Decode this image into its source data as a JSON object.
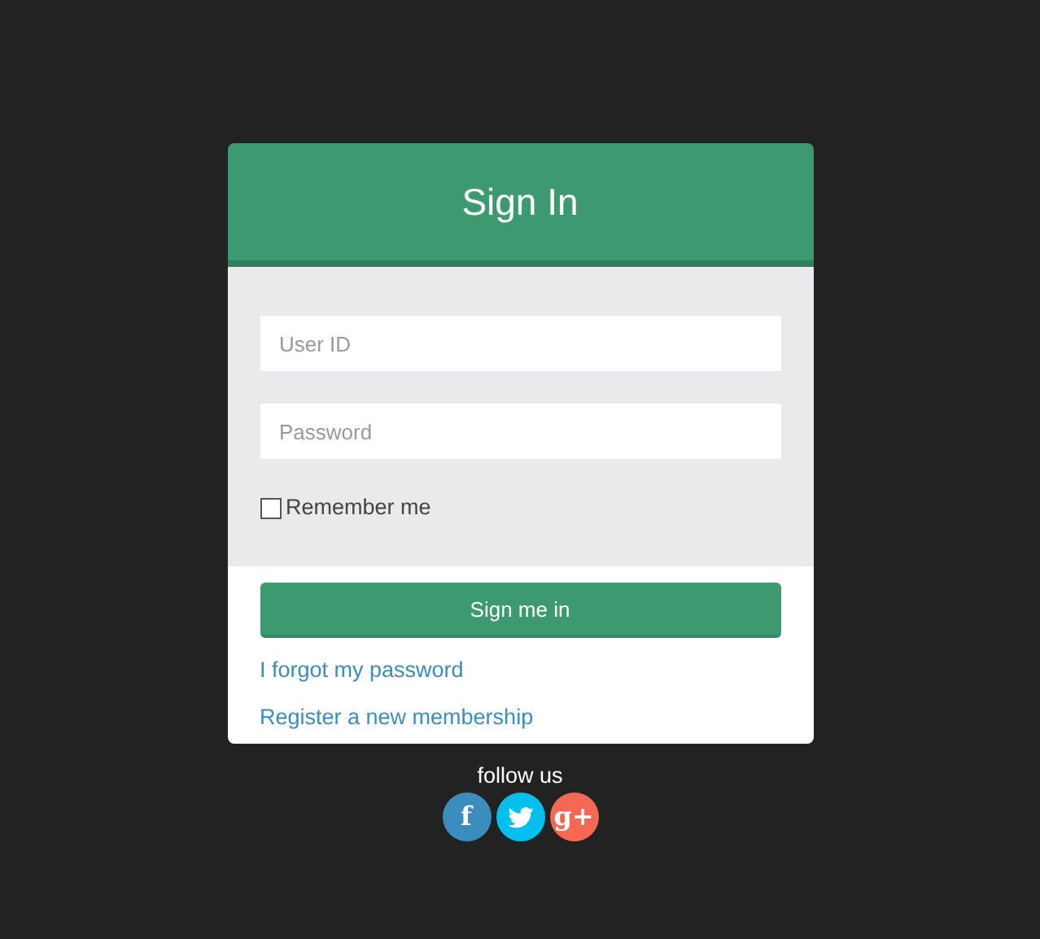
{
  "header": {
    "title": "Sign In"
  },
  "fields": [
    {
      "placeholder": "User ID"
    },
    {
      "placeholder": "Password"
    }
  ],
  "remember": {
    "label": "Remember me",
    "checked": false
  },
  "submit": {
    "label": "Sign me in"
  },
  "links": [
    "I forgot my password",
    "Register a new membership"
  ],
  "social": {
    "caption": "follow us",
    "buttons": [
      {
        "kind": "facebook",
        "label": "f",
        "color": "#3b8dbd"
      },
      {
        "kind": "twitter",
        "color": "#00c0ef"
      },
      {
        "kind": "google",
        "label": "g+",
        "color": "#f56954"
      }
    ]
  }
}
